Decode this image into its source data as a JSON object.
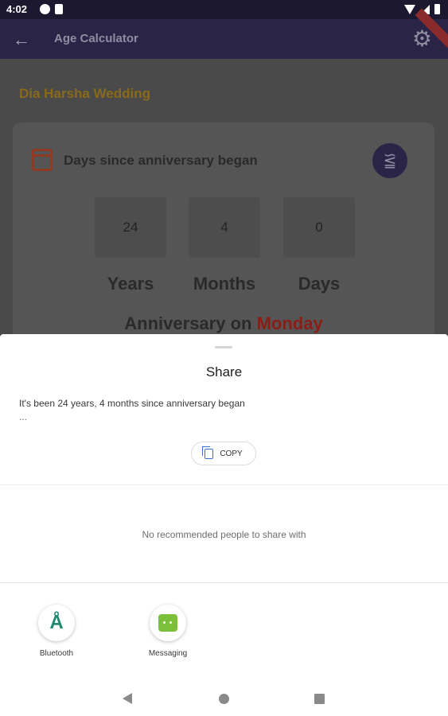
{
  "status_bar": {
    "time": "4:02"
  },
  "app_bar": {
    "title": "Age Calculator",
    "back_icon": "arrow-left-icon",
    "settings_icon": "gear-icon"
  },
  "background": {
    "event_title": "Dia Harsha Wedding",
    "card": {
      "heading": "Days since anniversary began",
      "stats": [
        {
          "value": "24",
          "label": "Years"
        },
        {
          "value": "4",
          "label": "Months"
        },
        {
          "value": "0",
          "label": "Days"
        }
      ],
      "anniversary_prefix": "Anniversary on",
      "anniversary_day": "Monday"
    }
  },
  "share_sheet": {
    "title": "Share",
    "text": "It's been 24 years, 4 months since anniversary began",
    "ellipsis": "...",
    "copy_label": "COPY",
    "no_people_text": "No recommended people to share with",
    "apps": [
      {
        "label": "Bluetooth",
        "icon": "bluetooth-icon"
      },
      {
        "label": "Messaging",
        "icon": "messaging-icon"
      }
    ]
  },
  "colors": {
    "app_bar": "#2a2447",
    "accent_gold": "#8a6a1a",
    "anniversary_day": "#8a1e14",
    "bluetooth": "#1f8a70",
    "messaging": "#7cbf3a"
  }
}
